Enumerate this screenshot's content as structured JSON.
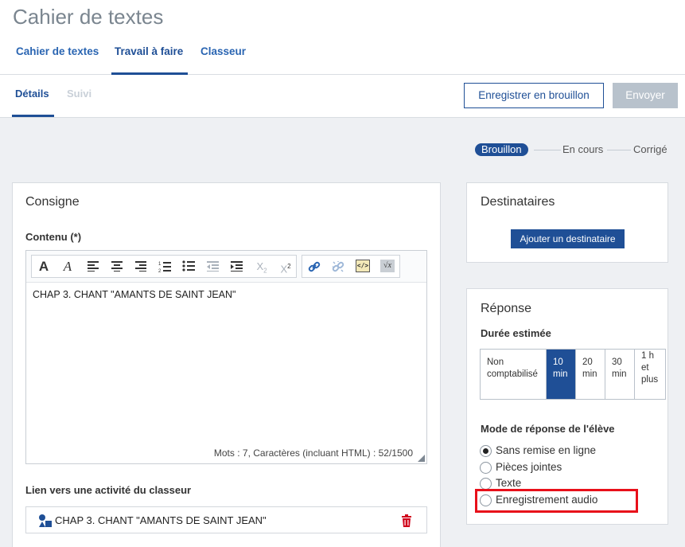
{
  "app": {
    "title": "Cahier de textes"
  },
  "main_tabs": [
    {
      "label": "Cahier de textes"
    },
    {
      "label": "Travail à faire"
    },
    {
      "label": "Classeur"
    }
  ],
  "sub_tabs": [
    {
      "label": "Détails"
    },
    {
      "label": "Suivi"
    }
  ],
  "actions": {
    "draft_label": "Enregistrer en brouillon",
    "send_label": "Envoyer"
  },
  "status_steps": [
    {
      "label": "Brouillon"
    },
    {
      "label": "En cours"
    },
    {
      "label": "Corrigé"
    }
  ],
  "consigne": {
    "title": "Consigne",
    "content_label": "Contenu (*)",
    "toolbar_icons": [
      "bold-icon",
      "italic-icon",
      "align-left-icon",
      "align-center-icon",
      "align-right-icon",
      "ordered-list-icon",
      "bullet-list-icon",
      "outdent-icon",
      "indent-icon",
      "subscript-icon",
      "superscript-icon",
      "link-icon",
      "unlink-icon",
      "source-code-icon",
      "math-formula-icon"
    ],
    "toolbar_glyphs": {
      "bold": "A",
      "italic": "A",
      "subscript_base": "X",
      "subscript_sub": "2",
      "superscript_base": "X",
      "superscript_sup": "2",
      "sqrt": "√x",
      "code": "</>"
    },
    "editor_text": "CHAP 3. CHANT \"AMANTS DE SAINT JEAN\"",
    "counter": "Mots : 7, Caractères (incluant HTML) : 52/1500",
    "link_label": "Lien vers une activité du classeur",
    "link_item": "CHAP 3. CHANT \"AMANTS DE SAINT JEAN\""
  },
  "destinataires": {
    "title": "Destinataires",
    "add_label": "Ajouter un destinataire"
  },
  "reponse": {
    "title": "Réponse",
    "duration_label": "Durée estimée",
    "durations": [
      {
        "line1": "Non",
        "line2": "comptabilisé",
        "line3": ""
      },
      {
        "line1": "10",
        "line2": "min",
        "line3": ""
      },
      {
        "line1": "20",
        "line2": "min",
        "line3": ""
      },
      {
        "line1": "30",
        "line2": "min",
        "line3": ""
      },
      {
        "line1": "1 h",
        "line2": "et",
        "line3": "plus"
      }
    ],
    "selected_duration": "10 min",
    "mode_label": "Mode de réponse de l'élève",
    "modes": [
      {
        "label": "Sans remise en ligne",
        "checked": true
      },
      {
        "label": "Pièces jointes",
        "checked": false
      },
      {
        "label": "Texte",
        "checked": false
      },
      {
        "label": "Enregistrement audio",
        "checked": false
      }
    ]
  },
  "colors": {
    "accent": "#1f4f96",
    "link": "#2a65b2",
    "highlight": "#e8101a",
    "disabled": "#b8c2cc"
  }
}
